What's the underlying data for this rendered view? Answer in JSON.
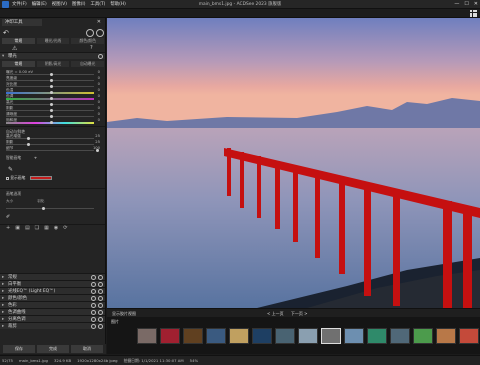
{
  "menu": {
    "items": [
      "文件(F)",
      "编辑(E)",
      "视图(V)",
      "图像(I)",
      "工具(T)",
      "帮助(H)"
    ],
    "title": "main_bms1.jpg - ACDSee 2023 旗舰版"
  },
  "panel": {
    "tab_label": "冲印工具",
    "sub_tabs": [
      "常规",
      "曝光/光线",
      "颜色/颜色"
    ],
    "sections_top": {
      "exposure": "曝光"
    },
    "exposure_mode_tabs": [
      "常规",
      "阴影/高光",
      "自动曝光"
    ],
    "sliders": [
      {
        "label": "曝光 = 0.00 eV",
        "value": "0"
      },
      {
        "label": "亮度级",
        "value": "0"
      },
      {
        "label": "对比度",
        "value": "0"
      },
      {
        "label": "色温",
        "value": "0"
      },
      {
        "label": "色调",
        "value": "0"
      },
      {
        "label": "高光",
        "value": "0"
      },
      {
        "label": "阴影",
        "value": "0"
      },
      {
        "label": "清晰度",
        "value": "0"
      },
      {
        "label": "饱和度",
        "value": "0"
      }
    ],
    "group_white": "自动与鲜艳",
    "sliders2": [
      {
        "label": "高光增强",
        "value": "25"
      },
      {
        "label": "阴影",
        "value": "25"
      },
      {
        "label": "细节",
        "value": "100"
      }
    ],
    "paint_label": "智能画笔",
    "show_mask_label": "显示画笔",
    "brush_section": "画笔选项",
    "brush_size_label": "大小",
    "brush_flow_label": "羽化",
    "sections": [
      "常规",
      "白平衡",
      "光线EQ™ (Light EQ™)",
      "颜色/颜色",
      "色彩",
      "色调曲线",
      "分离色调",
      "裁剪"
    ],
    "buttons": [
      "保存",
      "完成",
      "取消"
    ]
  },
  "filmstrip": {
    "bar_label": "显示胶片视图",
    "nav_prev": "< 上一页",
    "nav_next": "下一页 >",
    "folder": "图片",
    "thumb_colors": [
      "#7a6a66",
      "#a02030",
      "#604020",
      "#3a5a80",
      "#c0a060",
      "#1e3f63",
      "#496372",
      "#8a9fb0",
      "#707070",
      "#6d8fb0",
      "#2f8a6a",
      "#506878",
      "#4c9b4c",
      "#b87848",
      "#c44a3a",
      "#3e6d8f"
    ]
  },
  "statusbar": {
    "items": [
      "52/75",
      "main_bms1.jpg",
      "324.9 KB",
      "1920x1280x24b jpeg",
      "拍摄日期: 1/1/2021 11:30:07 AM",
      "54%"
    ]
  },
  "colors": {
    "accent": "#c31c1c",
    "panel": "#242424",
    "titlebar": "#262626"
  }
}
